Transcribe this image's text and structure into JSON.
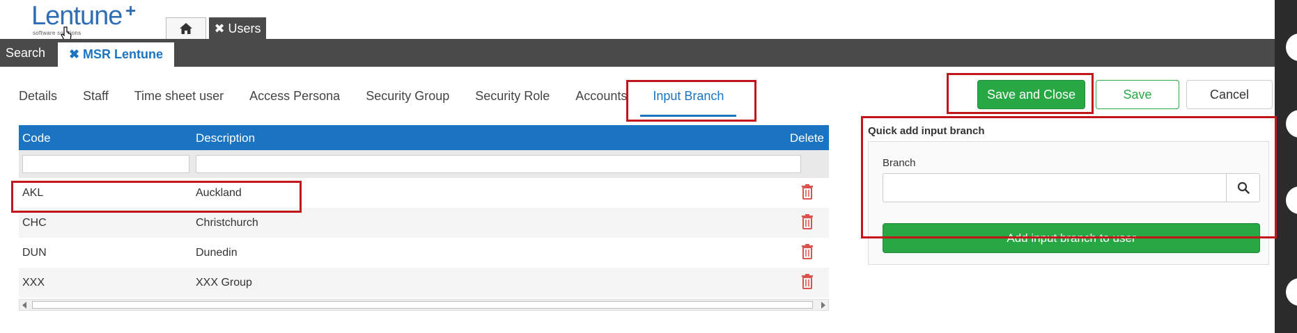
{
  "logo": {
    "name": "Lentune",
    "plus": "+",
    "tagline": "software solutions"
  },
  "top_tabs": {
    "home_icon": "home-icon",
    "users_label": "✖ Users"
  },
  "navbar": {
    "search_label": "Search",
    "record_tab_label": "✖ MSR Lentune"
  },
  "subtabs": [
    {
      "label": "Details"
    },
    {
      "label": "Staff"
    },
    {
      "label": "Time sheet user"
    },
    {
      "label": "Access Persona"
    },
    {
      "label": "Security Group"
    },
    {
      "label": "Security Role"
    },
    {
      "label": "Accounts"
    },
    {
      "label": "Input Branch"
    }
  ],
  "grid": {
    "columns": {
      "code": "Code",
      "description": "Description",
      "delete": "Delete"
    },
    "rows": [
      {
        "code": "AKL",
        "description": "Auckland"
      },
      {
        "code": "CHC",
        "description": "Christchurch"
      },
      {
        "code": "DUN",
        "description": "Dunedin"
      },
      {
        "code": "XXX",
        "description": "XXX Group"
      }
    ]
  },
  "actions": {
    "save_close": "Save and Close",
    "save": "Save",
    "cancel": "Cancel"
  },
  "quick_add": {
    "title": "Quick add input branch",
    "branch_label": "Branch",
    "branch_value": "",
    "add_button": "Add input branch to user"
  },
  "colors": {
    "accent": "#1a74c2",
    "success": "#28a745",
    "highlight": "#c0161c",
    "navbar": "#4a4a4a"
  }
}
